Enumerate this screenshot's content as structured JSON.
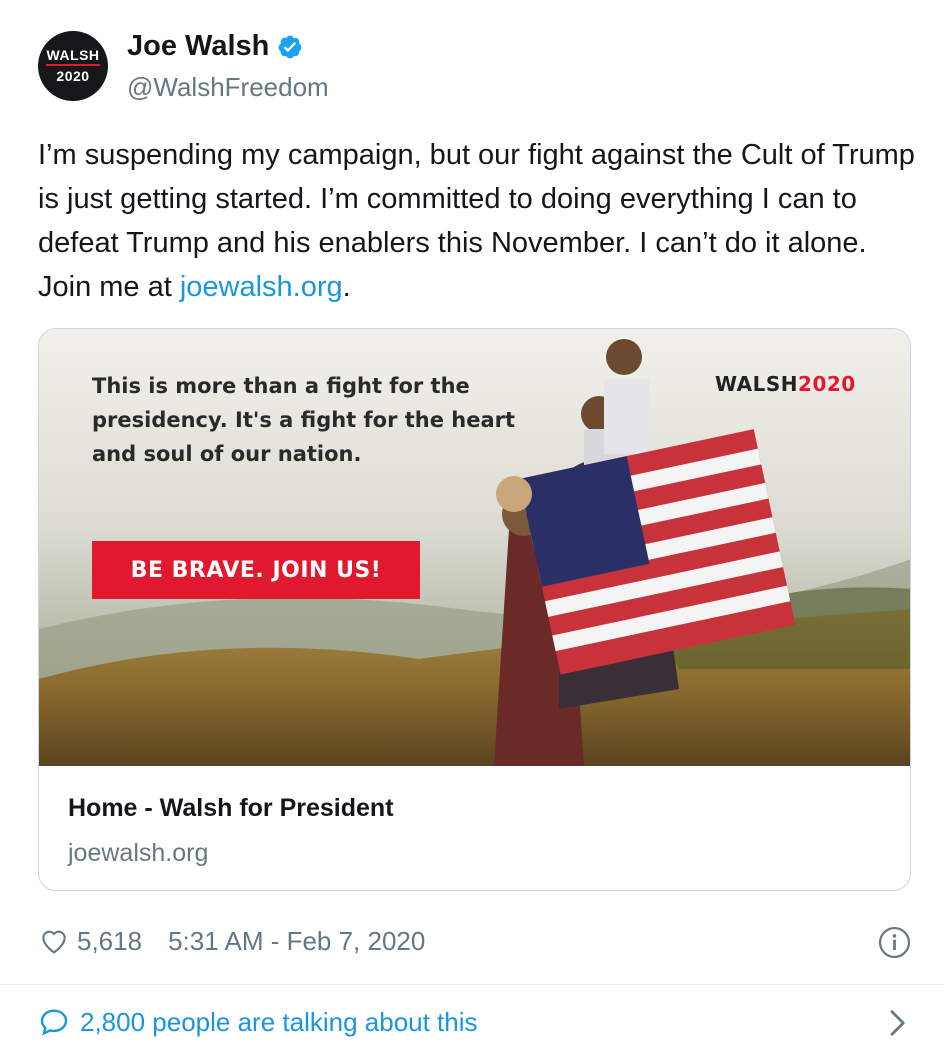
{
  "author": {
    "avatar_line1": "WALSH",
    "avatar_line2": "2020",
    "display_name": "Joe Walsh",
    "handle": "@WalshFreedom",
    "verified_icon": "verified-badge-icon"
  },
  "tweet": {
    "text": "I’m suspending my campaign, but our fight against the Cult of Trump is just getting started. I’m committed to doing everything I can to defeat Trump and his enablers this November. I can’t do it alone. Join me at ",
    "link_text": "joewalsh.org",
    "text_end": "."
  },
  "card": {
    "image_quote": "This is more than a fight for the presidency. It's a fight for the heart and soul of our nation.",
    "image_brand_name": "WALSH",
    "image_brand_year": "2020",
    "image_cta": "BE BRAVE. JOIN US!",
    "title": "Home - Walsh for President",
    "domain": "joewalsh.org"
  },
  "stats": {
    "likes": "5,618",
    "timestamp": "5:31 AM - Feb 7, 2020"
  },
  "footer": {
    "talking_text": "2,800 people are talking about this"
  },
  "colors": {
    "link": "#1b95e0",
    "secondary_text": "#657786",
    "brand_red": "#e0192f"
  }
}
